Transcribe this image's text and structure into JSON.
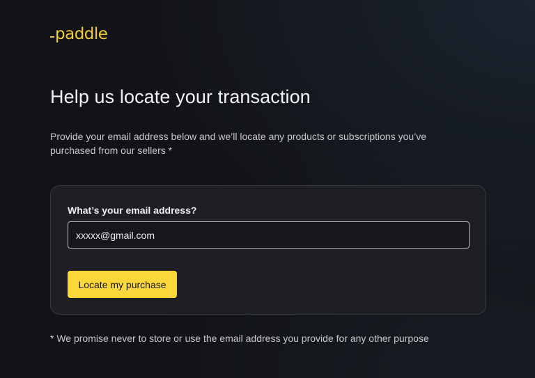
{
  "brand": {
    "name": "paddle",
    "accent_color": "#f2cb3a"
  },
  "header": {
    "title": "Help us locate your transaction",
    "description": "Provide your email address below and we’ll locate any products or subscriptions you’ve purchased from our sellers *"
  },
  "form": {
    "email_label": "What’s your email address?",
    "email_value": "xxxxx@gmail.com",
    "submit_label": "Locate my purchase",
    "button_color": "#fbd73a"
  },
  "footer": {
    "disclaimer": "* We promise never to store or use the email address you provide for any other purpose"
  }
}
